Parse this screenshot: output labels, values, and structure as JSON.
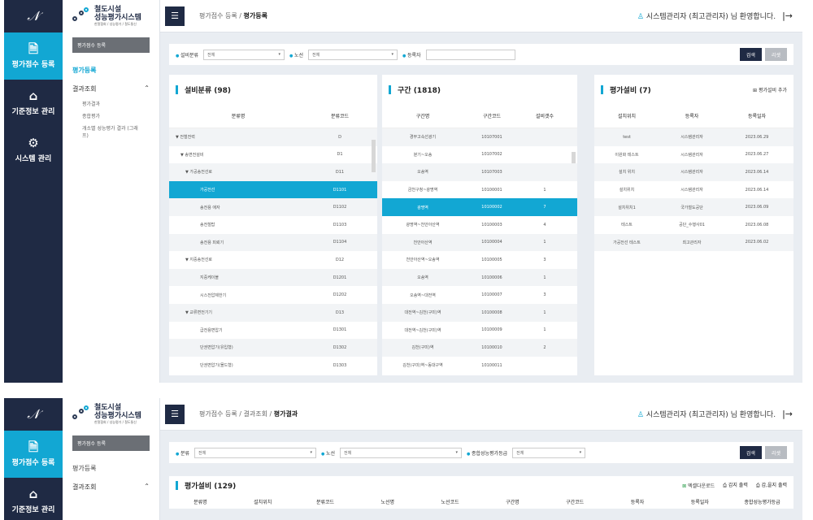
{
  "rail": {
    "items": [
      {
        "label": "평가점수 등록"
      },
      {
        "label": "기준정보 관리"
      },
      {
        "label": "시스템 관리"
      }
    ]
  },
  "brand": {
    "title1": "철도시설",
    "title2": "성능평가시스템",
    "sub": "한철협회 / 성능평가 / 철도통신"
  },
  "screen1": {
    "menu_box": "평가점수 등록",
    "submenu": {
      "register": "평가등록",
      "results": "결과조회",
      "children": [
        "평가결과",
        "종합평가",
        "개소별 성능평가 결과 (그래프)"
      ]
    },
    "breadcrumb": {
      "path": "평가점수 등록 / ",
      "current": "평가등록"
    },
    "user": "시스템관리자 (최고관리자) 님 환영합니다.",
    "filter": {
      "f1_label": "설비분류",
      "f1_value": "전체",
      "f2_label": "노선",
      "f2_value": "전체",
      "f3_label": "등록자",
      "search": "검색",
      "reset": "리셋"
    },
    "panel1": {
      "title": "설비분류 (98)",
      "headers": [
        "분류명",
        "분류코드"
      ],
      "rows": [
        {
          "name": "▼ 전철전력",
          "code": "D"
        },
        {
          "name": "▼ 송변전설비",
          "code": "D1"
        },
        {
          "name": "▼ 가공송전선로",
          "code": "D11"
        },
        {
          "name": "가공전선",
          "code": "D1101"
        },
        {
          "name": "송전용 애자",
          "code": "D1102"
        },
        {
          "name": "송전철탑",
          "code": "D1103"
        },
        {
          "name": "송전용 피뢰기",
          "code": "D1104"
        },
        {
          "name": "▼ 지중송전선로",
          "code": "D12"
        },
        {
          "name": "지중케이블",
          "code": "D1201"
        },
        {
          "name": "시스전압제한기",
          "code": "D1202"
        },
        {
          "name": "▼ 교류변전기기",
          "code": "D13"
        },
        {
          "name": "급전용변압기",
          "code": "D1301"
        },
        {
          "name": "단권변압기(유입형)",
          "code": "D1302"
        },
        {
          "name": "단권변압기(몰드형)",
          "code": "D1303"
        }
      ]
    },
    "panel2": {
      "title": "구간 (1818)",
      "headers": [
        "구간명",
        "구간코드",
        "설비갯수"
      ],
      "rows": [
        {
          "name": "경부고속선광기",
          "code": "10107001",
          "cnt": ""
        },
        {
          "name": "분기~오송",
          "code": "10107002",
          "cnt": ""
        },
        {
          "name": "오송역",
          "code": "10107003",
          "cnt": ""
        },
        {
          "name": "금천구청~광명역",
          "code": "10100001",
          "cnt": "1"
        },
        {
          "name": "광명역",
          "code": "10100002",
          "cnt": "7"
        },
        {
          "name": "광명역~천안아산역",
          "code": "10100003",
          "cnt": "4"
        },
        {
          "name": "천안아산역",
          "code": "10100004",
          "cnt": "1"
        },
        {
          "name": "천안아산역~오송역",
          "code": "10100005",
          "cnt": "3"
        },
        {
          "name": "오송역",
          "code": "10100006",
          "cnt": "1"
        },
        {
          "name": "오송역~대전역",
          "code": "10100007",
          "cnt": "3"
        },
        {
          "name": "대전역~김천(구미)역",
          "code": "10100008",
          "cnt": "1"
        },
        {
          "name": "대전역~김천(구미)역",
          "code": "10100009",
          "cnt": "1"
        },
        {
          "name": "김천(구미)역",
          "code": "10100010",
          "cnt": "2"
        },
        {
          "name": "김천(구미)역~동대구역",
          "code": "10100011",
          "cnt": ""
        }
      ]
    },
    "panel3": {
      "title": "평가설비 (7)",
      "add": "평가설비 추가",
      "headers": [
        "설치위치",
        "등록자",
        "등록일자"
      ],
      "rows": [
        {
          "loc": "test",
          "reg": "시스템관리자",
          "date": "2023.06.29"
        },
        {
          "loc": "이원화 테스트",
          "reg": "시스템관리자",
          "date": "2023.06.27"
        },
        {
          "loc": "설치 위치",
          "reg": "시스템관리자",
          "date": "2023.06.14"
        },
        {
          "loc": "설치위치",
          "reg": "시스템관리자",
          "date": "2023.06.14"
        },
        {
          "loc": "설치위치1",
          "reg": "국가철도공단",
          "date": "2023.06.09"
        },
        {
          "loc": "테스트",
          "reg": "공단_수행사01",
          "date": "2023.06.08"
        },
        {
          "loc": "가공전선 테스트",
          "reg": "최고관리자",
          "date": "2023.06.02"
        }
      ]
    }
  },
  "screen2": {
    "menu_box": "평가점수 등록",
    "submenu": {
      "register": "평가등록",
      "results": "결과조회"
    },
    "breadcrumb": {
      "path": "평가점수 등록 / 결과조회 / ",
      "current": "평가결과"
    },
    "user": "시스템관리자 (최고관리자) 님 환영합니다.",
    "filter": {
      "f1_label": "분류",
      "f1_value": "전체",
      "f2_label": "노선",
      "f2_value": "전체",
      "f3_label": "종합성능평가등급",
      "f3_value": "전체",
      "search": "검색",
      "reset": "리셋"
    },
    "panel": {
      "title": "평가설비 (129)",
      "btn1": "엑셀다운로드",
      "btn2": "갑지 출력",
      "btn3": "갑,을지 출력",
      "headers": [
        "분류명",
        "설치위치",
        "분류코드",
        "노선명",
        "노선코드",
        "구간명",
        "구간코드",
        "등록자",
        "등록일자",
        "종합성능평가등급"
      ]
    }
  },
  "colors": {
    "accent": "#12a7d3",
    "navy": "#1f2a44"
  }
}
